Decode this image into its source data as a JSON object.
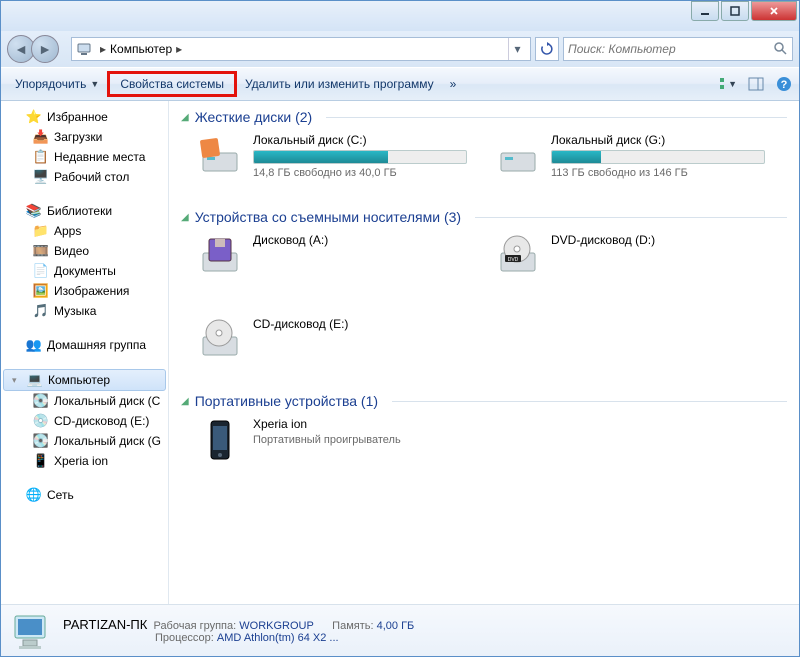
{
  "window": {
    "title": ""
  },
  "address": {
    "root": "Компьютер",
    "sep": "▸"
  },
  "search": {
    "placeholder": "Поиск: Компьютер"
  },
  "toolbar": {
    "organize": "Упорядочить",
    "system_props": "Свойства системы",
    "uninstall": "Удалить или изменить программу",
    "more": "»"
  },
  "sidebar": {
    "favorites": {
      "label": "Избранное",
      "items": [
        "Загрузки",
        "Недавние места",
        "Рабочий стол"
      ]
    },
    "libraries": {
      "label": "Библиотеки",
      "items": [
        "Apps",
        "Видео",
        "Документы",
        "Изображения",
        "Музыка"
      ]
    },
    "homegroup": {
      "label": "Домашняя группа"
    },
    "computer": {
      "label": "Компьютер",
      "items": [
        "Локальный диск (C",
        "CD-дисковод (E:)",
        "Локальный диск (G",
        "Xperia ion"
      ]
    },
    "network": {
      "label": "Сеть"
    }
  },
  "sections": {
    "hdd": {
      "title": "Жесткие диски (2)"
    },
    "removable": {
      "title": "Устройства со съемными носителями (3)"
    },
    "portable": {
      "title": "Портативные устройства (1)"
    }
  },
  "drives": {
    "c": {
      "name": "Локальный диск (C:)",
      "free": "14,8 ГБ свободно из 40,0 ГБ",
      "pct": 63
    },
    "g": {
      "name": "Локальный диск (G:)",
      "free": "113 ГБ свободно из 146 ГБ",
      "pct": 23
    },
    "a": {
      "name": "Дисковод (A:)"
    },
    "d": {
      "name": "DVD-дисковод (D:)"
    },
    "e": {
      "name": "CD-дисковод (E:)"
    },
    "xperia": {
      "name": "Xperia ion",
      "sub": "Портативный проигрыватель"
    }
  },
  "status": {
    "name": "PARTIZAN-ПК",
    "workgroup_label": "Рабочая группа:",
    "workgroup": "WORKGROUP",
    "cpu_label": "Процессор:",
    "cpu": "AMD Athlon(tm) 64 X2 ...",
    "mem_label": "Память:",
    "mem": "4,00 ГБ"
  }
}
